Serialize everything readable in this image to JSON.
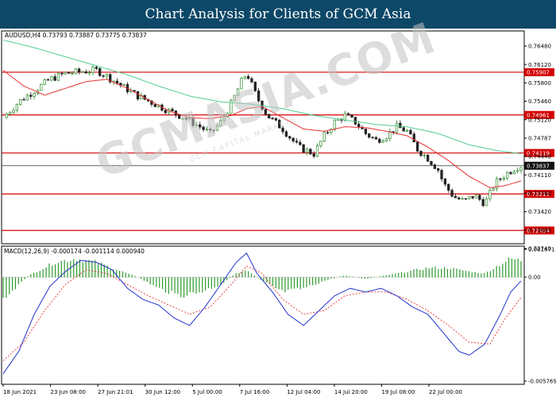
{
  "page": {
    "banner_title": "Chart Analysis for Clients of GCM Asia",
    "watermark": "GCMASIA.COM",
    "watermark_sub": "GCM CAPITAL MARKETS"
  },
  "colors": {
    "banner": "#0e4868",
    "bull_candle": "#2e8b2e",
    "bear_candle": "#222222",
    "ma_fast": "#e83030",
    "ma_slow": "#4fcf90",
    "level_line": "#d40000",
    "macd_hist": "#2e9a2e",
    "macd_line": "#2233cc",
    "signal_line": "#e83030"
  },
  "chart_data": [
    {
      "type": "candlestick",
      "title": "AUDUSD,H4  0.73793 0.73887 0.73775 0.73837",
      "symbol": "AUDUSD",
      "timeframe": "H4",
      "ohlc_label": "0.73793 0.73887 0.73775 0.73837",
      "ylim": [
        0.7211,
        0.7682
      ],
      "y_ticks": [
        "0.76480",
        "0.76120",
        "0.75800",
        "0.75460",
        "0.75120",
        "0.74787",
        "0.74440",
        "0.74110",
        "0.73760",
        "0.73420",
        "0.73085",
        "0.72740"
      ],
      "x_ticks": [
        "18 Jun 2021",
        "23 Jun 08:00",
        "27 Jun 21:01",
        "30 Jun 12:00",
        "5 Jul 00:00",
        "7 Jul 16:00",
        "12 Jul 04:00",
        "14 Jul 20:00",
        "19 Jul 08:00",
        "22 Jul 00:00"
      ],
      "levels": [
        {
          "value": 0.75907,
          "label": "0.75907"
        },
        {
          "value": 0.74961,
          "label": "0.74961"
        },
        {
          "value": 0.74119,
          "label": "0.74119"
        },
        {
          "value": 0.73213,
          "label": "0.73213"
        },
        {
          "value": 0.72404,
          "label": "0.72404"
        }
      ],
      "current_price": {
        "value": 0.73837,
        "label": "0.73837"
      },
      "close_path": [
        [
          0,
          0.749
        ],
        [
          3,
          0.7525
        ],
        [
          6,
          0.755
        ],
        [
          9,
          0.7575
        ],
        [
          12,
          0.7588
        ],
        [
          15,
          0.7592
        ],
        [
          18,
          0.7595
        ],
        [
          20,
          0.7582
        ],
        [
          23,
          0.756
        ],
        [
          26,
          0.7538
        ],
        [
          29,
          0.7522
        ],
        [
          32,
          0.7505
        ],
        [
          35,
          0.749
        ],
        [
          38,
          0.747
        ],
        [
          40,
          0.7455
        ],
        [
          42,
          0.748
        ],
        [
          44,
          0.752
        ],
        [
          46,
          0.757
        ],
        [
          47,
          0.759
        ],
        [
          49,
          0.7535
        ],
        [
          51,
          0.7495
        ],
        [
          54,
          0.7465
        ],
        [
          57,
          0.7425
        ],
        [
          60,
          0.741
        ],
        [
          62,
          0.745
        ],
        [
          64,
          0.748
        ],
        [
          66,
          0.7495
        ],
        [
          68,
          0.748
        ],
        [
          70,
          0.7455
        ],
        [
          72,
          0.744
        ],
        [
          74,
          0.745
        ],
        [
          76,
          0.747
        ],
        [
          78,
          0.746
        ],
        [
          80,
          0.742
        ],
        [
          82,
          0.74
        ],
        [
          84,
          0.7375
        ],
        [
          85,
          0.7345
        ],
        [
          87,
          0.7315
        ],
        [
          89,
          0.7305
        ],
        [
          91,
          0.7318
        ],
        [
          93,
          0.73
        ],
        [
          95,
          0.7345
        ],
        [
          97,
          0.7365
        ],
        [
          99,
          0.738
        ],
        [
          100,
          0.73837
        ]
      ],
      "ma_fast_path": [
        [
          0,
          0.7595
        ],
        [
          4,
          0.756
        ],
        [
          8,
          0.754
        ],
        [
          12,
          0.7555
        ],
        [
          16,
          0.757
        ],
        [
          20,
          0.7575
        ],
        [
          24,
          0.7555
        ],
        [
          28,
          0.753
        ],
        [
          32,
          0.7505
        ],
        [
          36,
          0.749
        ],
        [
          40,
          0.7488
        ],
        [
          44,
          0.7495
        ],
        [
          47,
          0.751
        ],
        [
          50,
          0.7515
        ],
        [
          54,
          0.749
        ],
        [
          58,
          0.7465
        ],
        [
          62,
          0.746
        ],
        [
          66,
          0.747
        ],
        [
          70,
          0.7468
        ],
        [
          74,
          0.746
        ],
        [
          78,
          0.745
        ],
        [
          82,
          0.7425
        ],
        [
          86,
          0.7395
        ],
        [
          90,
          0.736
        ],
        [
          94,
          0.7335
        ],
        [
          97,
          0.734
        ],
        [
          100,
          0.735
        ]
      ],
      "ma_slow_path": [
        [
          0,
          0.7662
        ],
        [
          6,
          0.7645
        ],
        [
          12,
          0.7625
        ],
        [
          18,
          0.7605
        ],
        [
          24,
          0.7585
        ],
        [
          30,
          0.756
        ],
        [
          36,
          0.7538
        ],
        [
          42,
          0.7525
        ],
        [
          48,
          0.752
        ],
        [
          54,
          0.751
        ],
        [
          60,
          0.7495
        ],
        [
          66,
          0.7485
        ],
        [
          72,
          0.7475
        ],
        [
          78,
          0.747
        ],
        [
          84,
          0.7455
        ],
        [
          90,
          0.743
        ],
        [
          95,
          0.7418
        ],
        [
          100,
          0.741
        ]
      ]
    },
    {
      "type": "macd",
      "title": "MACD(12,26,9) -0.000174 -0.001114 0.000940",
      "params": "MACD(12,26,9)",
      "values_label": "-0.000174 -0.001114 0.000940",
      "ylim": [
        -0.005769,
        0.001671
      ],
      "y_ticks": [
        "0.001671",
        "0.00",
        "-0.005769"
      ],
      "hist_path": [
        [
          0,
          -0.0012
        ],
        [
          5,
          0.0001
        ],
        [
          10,
          0.0008
        ],
        [
          14,
          0.001
        ],
        [
          18,
          0.0008
        ],
        [
          22,
          0.0004
        ],
        [
          26,
          0.0
        ],
        [
          30,
          -0.0006
        ],
        [
          34,
          -0.001
        ],
        [
          38,
          -0.0008
        ],
        [
          42,
          -0.0004
        ],
        [
          45,
          0.0002
        ],
        [
          47,
          0.0004
        ],
        [
          50,
          -0.0002
        ],
        [
          54,
          -0.0008
        ],
        [
          58,
          -0.0006
        ],
        [
          62,
          -0.0002
        ],
        [
          66,
          0.0001
        ],
        [
          70,
          -0.0001
        ],
        [
          74,
          0.0001
        ],
        [
          78,
          0.0003
        ],
        [
          82,
          0.0005
        ],
        [
          86,
          0.0005
        ],
        [
          90,
          0.0003
        ],
        [
          93,
          0.0002
        ],
        [
          96,
          0.0007
        ],
        [
          98,
          0.001
        ],
        [
          100,
          0.0009
        ]
      ],
      "macd_path": [
        [
          0,
          -0.0052
        ],
        [
          3,
          -0.004
        ],
        [
          6,
          -0.002
        ],
        [
          9,
          -0.0005
        ],
        [
          12,
          0.0003
        ],
        [
          15,
          0.0009
        ],
        [
          18,
          0.0008
        ],
        [
          21,
          0.0004
        ],
        [
          24,
          -0.0006
        ],
        [
          27,
          -0.0012
        ],
        [
          30,
          -0.0015
        ],
        [
          33,
          -0.0022
        ],
        [
          36,
          -0.0026
        ],
        [
          39,
          -0.0016
        ],
        [
          42,
          -0.0004
        ],
        [
          45,
          0.0008
        ],
        [
          47,
          0.0013
        ],
        [
          49,
          0.0002
        ],
        [
          52,
          -0.0008
        ],
        [
          55,
          -0.002
        ],
        [
          58,
          -0.0026
        ],
        [
          61,
          -0.0018
        ],
        [
          64,
          -0.001
        ],
        [
          67,
          -0.0006
        ],
        [
          70,
          -0.0008
        ],
        [
          73,
          -0.0006
        ],
        [
          76,
          -0.001
        ],
        [
          79,
          -0.0016
        ],
        [
          82,
          -0.002
        ],
        [
          85,
          -0.003
        ],
        [
          88,
          -0.004
        ],
        [
          90,
          -0.0042
        ],
        [
          93,
          -0.0036
        ],
        [
          96,
          -0.002
        ],
        [
          98,
          -0.0008
        ],
        [
          100,
          -0.0002
        ]
      ],
      "signal_path": [
        [
          0,
          -0.0045
        ],
        [
          4,
          -0.0035
        ],
        [
          8,
          -0.0018
        ],
        [
          12,
          -0.0004
        ],
        [
          16,
          0.0004
        ],
        [
          20,
          0.0002
        ],
        [
          24,
          -0.0004
        ],
        [
          28,
          -0.001
        ],
        [
          32,
          -0.0015
        ],
        [
          36,
          -0.002
        ],
        [
          40,
          -0.0016
        ],
        [
          44,
          -0.0004
        ],
        [
          47,
          0.0006
        ],
        [
          50,
          0.0002
        ],
        [
          54,
          -0.0012
        ],
        [
          58,
          -0.002
        ],
        [
          62,
          -0.0018
        ],
        [
          66,
          -0.001
        ],
        [
          70,
          -0.0008
        ],
        [
          74,
          -0.0008
        ],
        [
          78,
          -0.0012
        ],
        [
          82,
          -0.0018
        ],
        [
          86,
          -0.0026
        ],
        [
          90,
          -0.0035
        ],
        [
          94,
          -0.0036
        ],
        [
          97,
          -0.0022
        ],
        [
          100,
          -0.0011
        ]
      ]
    }
  ]
}
